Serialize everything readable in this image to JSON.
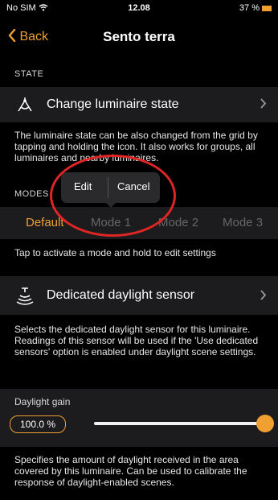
{
  "status": {
    "carrier": "No SIM",
    "time": "12.08",
    "battery": "37 %"
  },
  "nav": {
    "back_label": "Back",
    "title": "Sento terra"
  },
  "state": {
    "section_label": "STATE",
    "change_label": "Change luminaire state",
    "description": "The luminaire state can be also changed from the grid by tapping and holding the icon. It also works for groups, all luminaires and nearby luminaires."
  },
  "modes": {
    "section_label": "MODES",
    "items": [
      "Default",
      "Mode 1",
      "Mode 2",
      "Mode 3"
    ],
    "active_index": 0,
    "hint": "Tap to activate a mode and hold to edit settings"
  },
  "popup": {
    "edit_label": "Edit",
    "cancel_label": "Cancel"
  },
  "sensor": {
    "label": "Dedicated daylight sensor",
    "description": "Selects the dedicated daylight sensor for this luminaire. Readings of this sensor will be used if the 'Use dedicated sensors' option is enabled under daylight scene settings."
  },
  "gain": {
    "label": "Daylight gain",
    "value_text": "100.0 %",
    "value_fraction": 1.0,
    "description": "Specifies the amount of daylight received in the area covered by this luminaire. Can be used to calibrate the response of daylight-enabled scenes."
  },
  "colors": {
    "accent": "#f0a030",
    "highlight": "#e02525"
  }
}
